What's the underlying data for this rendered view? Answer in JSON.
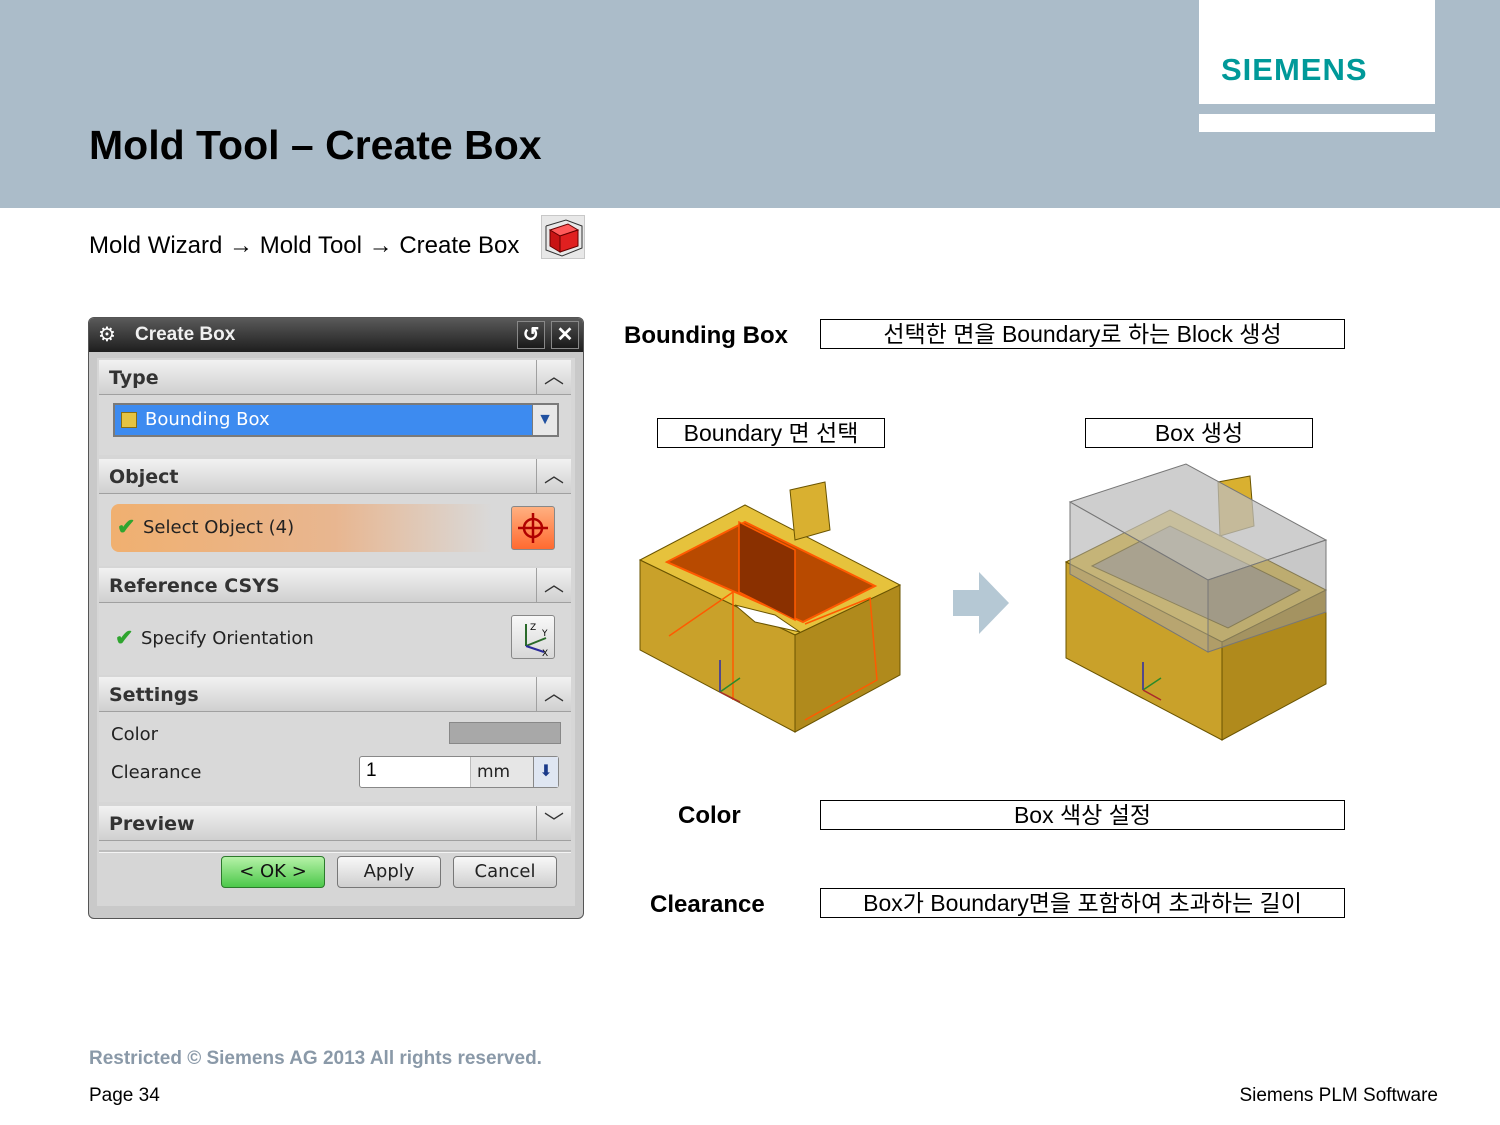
{
  "header": {
    "logo_text": "SIEMENS",
    "title": "Mold Tool – Create Box"
  },
  "breadcrumb": {
    "step1": "Mold Wizard",
    "step2": "Mold Tool",
    "step3": "Create Box",
    "arrow": "→",
    "icon": "create-box-icon"
  },
  "dialog": {
    "title": "Create Box",
    "sections": {
      "type": {
        "label": "Type",
        "selected": "Bounding Box"
      },
      "object": {
        "label": "Object",
        "select_label": "Select Object (4)"
      },
      "reference_csys": {
        "label": "Reference CSYS",
        "orient_label": "Specify Orientation"
      },
      "settings": {
        "label": "Settings",
        "color_label": "Color",
        "clearance_label": "Clearance",
        "clearance_value": "1",
        "clearance_unit": "mm"
      },
      "preview": {
        "label": "Preview"
      }
    },
    "buttons": {
      "ok": "< OK >",
      "apply": "Apply",
      "cancel": "Cancel"
    },
    "colors": {
      "select_highlight": "#f0b070",
      "ok_button": "#4cc84a",
      "type_selected": "#3d8bf0"
    }
  },
  "explain": {
    "bounding_box": {
      "label": "Bounding Box",
      "desc": "선택한 면을 Boundary로 하는 Block 생성"
    },
    "step_left": "Boundary 면 선택",
    "step_right": "Box 생성",
    "color": {
      "label": "Color",
      "desc": "Box 색상 설정"
    },
    "clearance": {
      "label": "Clearance",
      "desc": "Box가 Boundary면을 포함하여 초과하는 길이"
    }
  },
  "footer": {
    "copyright": "Restricted © Siemens AG 2013 All rights reserved.",
    "page": "Page 34",
    "company": "Siemens PLM Software"
  }
}
